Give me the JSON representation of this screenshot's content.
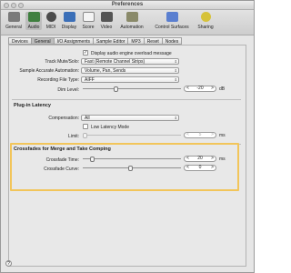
{
  "window": {
    "title": "Preferences"
  },
  "toolbar": {
    "items": [
      {
        "label": "General",
        "icon": "switch-icon"
      },
      {
        "label": "Audio",
        "icon": "audio-interface-icon"
      },
      {
        "label": "MIDI",
        "icon": "midi-icon"
      },
      {
        "label": "Display",
        "icon": "display-icon"
      },
      {
        "label": "Score",
        "icon": "score-icon"
      },
      {
        "label": "Video",
        "icon": "video-icon"
      },
      {
        "label": "Automation",
        "icon": "automation-icon"
      },
      {
        "label": "Control Surfaces",
        "icon": "control-surfaces-icon"
      },
      {
        "label": "Sharing",
        "icon": "sharing-icon"
      }
    ],
    "active": "Audio"
  },
  "tabs": [
    "Devices",
    "General",
    "I/O Assignments",
    "Sample Editor",
    "MP3",
    "Reset",
    "Nodes"
  ],
  "active_tab": "General",
  "general": {
    "display_overload_label": "Display audio engine overload message",
    "display_overload_checked": "✓",
    "track_mute_solo_label": "Track Mute/Solo:",
    "track_mute_solo_value": "Fast (Remote Channel Strips)",
    "sample_accurate_label": "Sample Accurate Automation:",
    "sample_accurate_value": "Volume, Pan, Sends",
    "recording_file_type_label": "Recording File Type:",
    "recording_file_type_value": "AIFF",
    "dim_level_label": "Dim Level:",
    "dim_level_value": "-20",
    "dim_level_unit": "dB"
  },
  "plugin_latency": {
    "section_title": "Plug-in Latency",
    "compensation_label": "Compensation:",
    "compensation_value": "All",
    "low_latency_label": "Low Latency Mode",
    "limit_label": "Limit:",
    "limit_value": "5",
    "limit_unit": "ms"
  },
  "crossfades": {
    "section_title": "Crossfades for Merge and Take Comping",
    "time_label": "Crossfade Time:",
    "time_value": "20",
    "time_unit": "ms",
    "curve_label": "Crossfade Curve:",
    "curve_value": "0"
  },
  "colors": {
    "highlight": "#f2c55a",
    "accent": "#2a6bc7"
  }
}
